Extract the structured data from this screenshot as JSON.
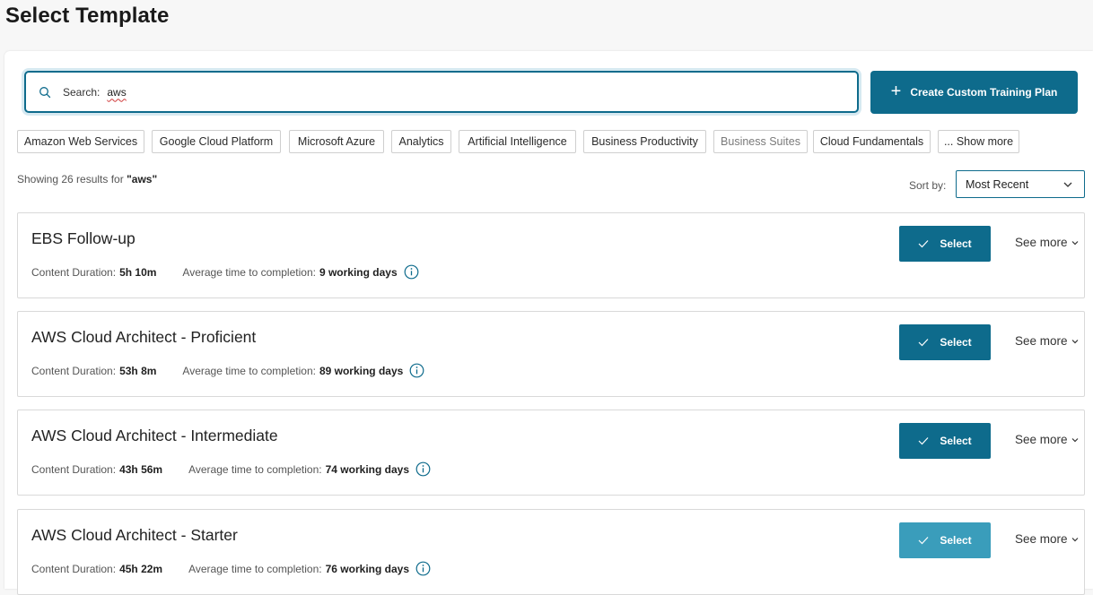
{
  "page": {
    "title": "Select Template"
  },
  "search": {
    "label": "Search:",
    "value": "aws"
  },
  "create_button": {
    "label": "Create Custom Training Plan"
  },
  "chips": [
    {
      "label": "Amazon Web Services",
      "muted": false
    },
    {
      "label": "Google Cloud Platform",
      "muted": false
    },
    {
      "label": "Microsoft Azure",
      "muted": false
    },
    {
      "label": "Analytics",
      "muted": false
    },
    {
      "label": "Artificial Intelligence",
      "muted": false
    },
    {
      "label": "Business Productivity",
      "muted": false
    },
    {
      "label": "Business Suites",
      "muted": true
    },
    {
      "label": "Cloud Fundamentals",
      "muted": false
    },
    {
      "label": "... Show more",
      "muted": false
    }
  ],
  "results": {
    "prefix": "Showing 26 results for",
    "query": "\"aws\""
  },
  "sort": {
    "label": "Sort by:",
    "selected": "Most Recent"
  },
  "card_labels": {
    "duration": "Content Duration:",
    "avg_time": "Average time to completion:",
    "select": "Select",
    "see_more": "See more"
  },
  "cards": [
    {
      "title": "EBS Follow-up",
      "duration": "5h 10m",
      "avg_time": "9 working days",
      "hover": false
    },
    {
      "title": "AWS Cloud Architect - Proficient",
      "duration": "53h 8m",
      "avg_time": "89 working days",
      "hover": false
    },
    {
      "title": "AWS Cloud Architect - Intermediate",
      "duration": "43h 56m",
      "avg_time": "74 working days",
      "hover": false
    },
    {
      "title": "AWS Cloud Architect - Starter",
      "duration": "45h 22m",
      "avg_time": "76 working days",
      "hover": true
    }
  ],
  "colors": {
    "primary": "#0e6b8c",
    "primary_hover": "#3a9dbb",
    "focus_ring": "#d6e9f1"
  },
  "icons": [
    "search-icon",
    "plus-icon",
    "chevron-down-icon",
    "check-icon",
    "info-icon"
  ]
}
